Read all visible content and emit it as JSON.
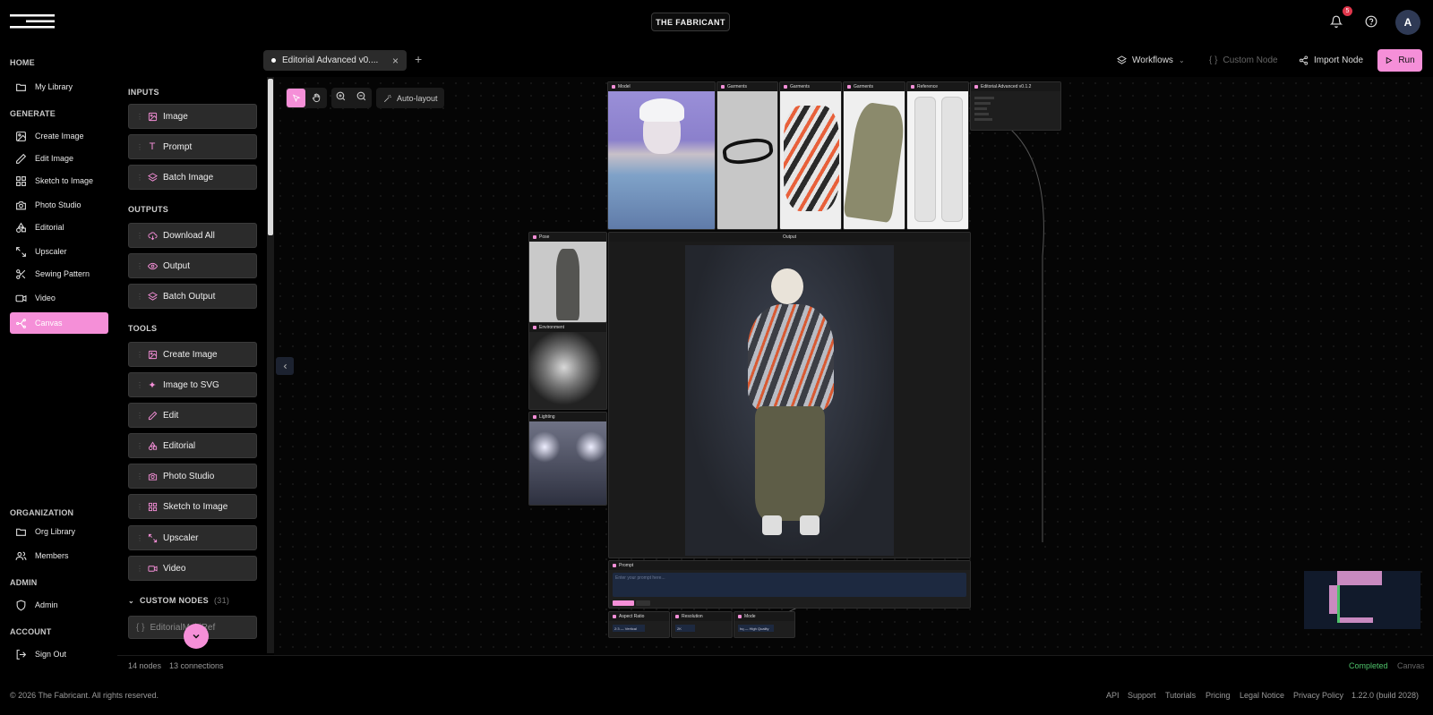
{
  "header": {
    "brand": "THE FABRICANT",
    "notification_count": "5",
    "avatar_initial": "A"
  },
  "nav": {
    "home_label": "HOME",
    "home_items": [
      {
        "label": "My Library",
        "icon": "folder-icon"
      }
    ],
    "generate_label": "GENERATE",
    "generate_items": [
      {
        "label": "Create Image",
        "icon": "image-icon"
      },
      {
        "label": "Edit Image",
        "icon": "pencil-icon"
      },
      {
        "label": "Sketch to Image",
        "icon": "grid-icon"
      },
      {
        "label": "Photo Studio",
        "icon": "camera-icon"
      },
      {
        "label": "Editorial",
        "icon": "shapes-icon"
      },
      {
        "label": "Upscaler",
        "icon": "upscale-icon"
      },
      {
        "label": "Sewing Pattern",
        "icon": "scissors-icon"
      },
      {
        "label": "Video",
        "icon": "video-icon"
      },
      {
        "label": "Canvas",
        "icon": "workflow-icon"
      }
    ],
    "organization_label": "ORGANIZATION",
    "organization_items": [
      {
        "label": "Org Library",
        "icon": "folder-icon"
      },
      {
        "label": "Members",
        "icon": "users-icon"
      }
    ],
    "admin_label": "ADMIN",
    "admin_items": [
      {
        "label": "Admin",
        "icon": "shield-icon"
      }
    ],
    "account_label": "ACCOUNT",
    "account_items": [
      {
        "label": "Sign Out",
        "icon": "logout-icon"
      }
    ]
  },
  "palette": {
    "inputs_label": "INPUTS",
    "inputs": [
      "Image",
      "Prompt",
      "Batch Image"
    ],
    "outputs_label": "OUTPUTS",
    "outputs": [
      "Download All",
      "Output",
      "Batch Output"
    ],
    "tools_label": "TOOLS",
    "tools": [
      "Create Image",
      "Image to SVG",
      "Edit",
      "Editorial",
      "Photo Studio",
      "Sketch to Image",
      "Upscaler",
      "Video"
    ],
    "custom_label": "CUSTOM NODES",
    "custom_count": "(31)",
    "custom_first": "EditorialMultiRef"
  },
  "tab": {
    "title": "Editorial Advanced v0....",
    "close": "×",
    "add": "+"
  },
  "toolbar": {
    "workflows": "Workflows",
    "custom_node": "Custom Node",
    "import_node": "Import Node",
    "run": "Run",
    "auto_layout": "Auto-layout"
  },
  "nodes": {
    "model": "Model",
    "garments": "Garments",
    "reference": "Reference",
    "editorial": "Editorial Advanced v0.1.2",
    "pose": "Pose",
    "environment": "Environment",
    "lighting": "Lighting",
    "output": "Output",
    "prompt": "Prompt",
    "prompt_placeholder": "Enter your prompt here...",
    "aspect_ratio": "Aspect Ratio",
    "aspect_value": "2:3 — Vertical",
    "resolution": "Resolution",
    "resolution_value": "2K",
    "mode": "Mode",
    "mode_value": "hq — High Quality"
  },
  "status": {
    "nodes": "14 nodes",
    "connections": "13 connections",
    "state": "Completed",
    "context": "Canvas"
  },
  "footer": {
    "copyright": "© 2026 The Fabricant. All rights reserved.",
    "links": [
      "API",
      "Support",
      "Tutorials",
      "Pricing",
      "Legal Notice",
      "Privacy Policy"
    ],
    "version": "1.22.0 (build 2028)"
  },
  "colors": {
    "accent": "#f58fd8",
    "completed": "#4ec26a"
  }
}
